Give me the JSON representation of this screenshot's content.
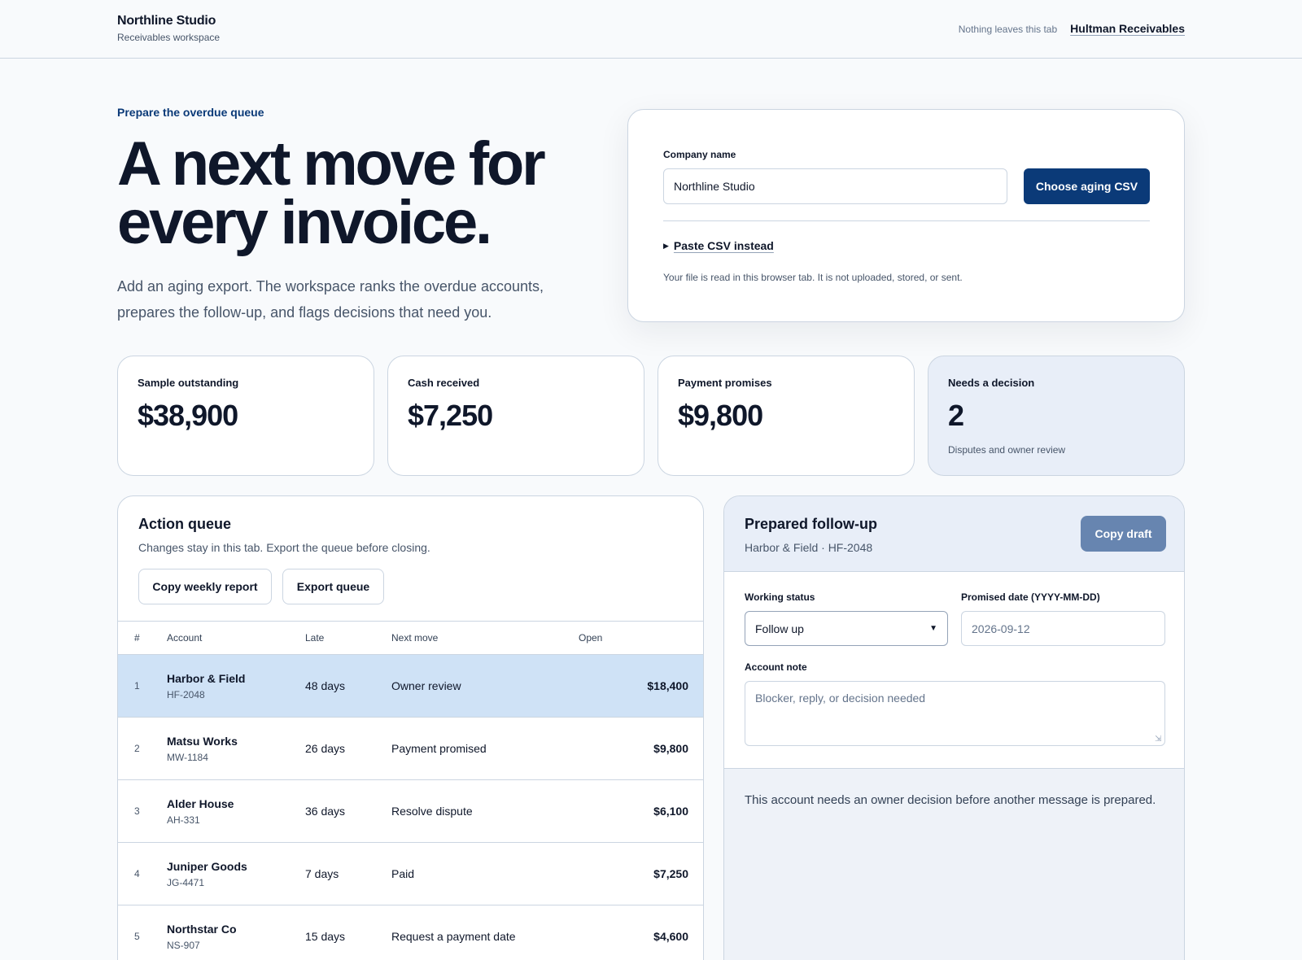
{
  "header": {
    "brand_name": "Northline Studio",
    "brand_sub": "Receivables workspace",
    "privacy_note": "Nothing leaves this tab",
    "workspace_link": "Hultman Receivables"
  },
  "hero": {
    "eyebrow": "Prepare the overdue queue",
    "headline_line1": "A next move for",
    "headline_line2": "every invoice.",
    "lead_line1": "Add an aging export. The workspace ranks the overdue accounts,",
    "lead_line2": "prepares the follow-up, and flags decisions that need you."
  },
  "upload": {
    "company_label": "Company name",
    "company_value": "Northline Studio",
    "choose_button": "Choose aging CSV",
    "paste_toggle": "Paste CSV instead",
    "file_note": "Your file is read in this browser tab. It is not uploaded, stored, or sent."
  },
  "stats": [
    {
      "label": "Sample outstanding",
      "value": "$38,900",
      "note": ""
    },
    {
      "label": "Cash received",
      "value": "$7,250",
      "note": ""
    },
    {
      "label": "Payment promises",
      "value": "$9,800",
      "note": ""
    },
    {
      "label": "Needs a decision",
      "value": "2",
      "note": "Disputes and owner review"
    }
  ],
  "queue": {
    "title": "Action queue",
    "subtitle": "Changes stay in this tab. Export the queue before closing.",
    "copy_report_button": "Copy weekly report",
    "export_button": "Export queue",
    "columns": [
      "#",
      "Account",
      "Late",
      "Next move",
      "Open"
    ],
    "rows": [
      {
        "num": "1",
        "account": "Harbor & Field",
        "id": "HF-2048",
        "late": "48 days",
        "move": "Owner review",
        "open": "$18,400",
        "selected": true
      },
      {
        "num": "2",
        "account": "Matsu Works",
        "id": "MW-1184",
        "late": "26 days",
        "move": "Payment promised",
        "open": "$9,800",
        "selected": false
      },
      {
        "num": "3",
        "account": "Alder House",
        "id": "AH-331",
        "late": "36 days",
        "move": "Resolve dispute",
        "open": "$6,100",
        "selected": false
      },
      {
        "num": "4",
        "account": "Juniper Goods",
        "id": "JG-4471",
        "late": "7 days",
        "move": "Paid",
        "open": "$7,250",
        "selected": false
      },
      {
        "num": "5",
        "account": "Northstar Co",
        "id": "NS-907",
        "late": "15 days",
        "move": "Request a payment date",
        "open": "$4,600",
        "selected": false
      }
    ]
  },
  "followup": {
    "title": "Prepared follow-up",
    "subtitle": "Harbor & Field · HF-2048",
    "copy_button": "Copy draft",
    "status_label": "Working status",
    "status_value": "Follow up",
    "date_label": "Promised date (YYYY-MM-DD)",
    "date_placeholder": "2026-09-12",
    "note_label": "Account note",
    "note_placeholder": "Blocker, reply, or decision needed",
    "message": "This account needs an owner decision before another message is prepared."
  },
  "icons": {
    "paste_caret": "caret-right-icon",
    "select_chevron": "chevron-down-icon",
    "textarea_grip": "resize-grip-icon"
  },
  "colors": {
    "accent": "#0b3a78",
    "selected_row": "#cfe2f6",
    "disabled_button": "#6785b0"
  }
}
